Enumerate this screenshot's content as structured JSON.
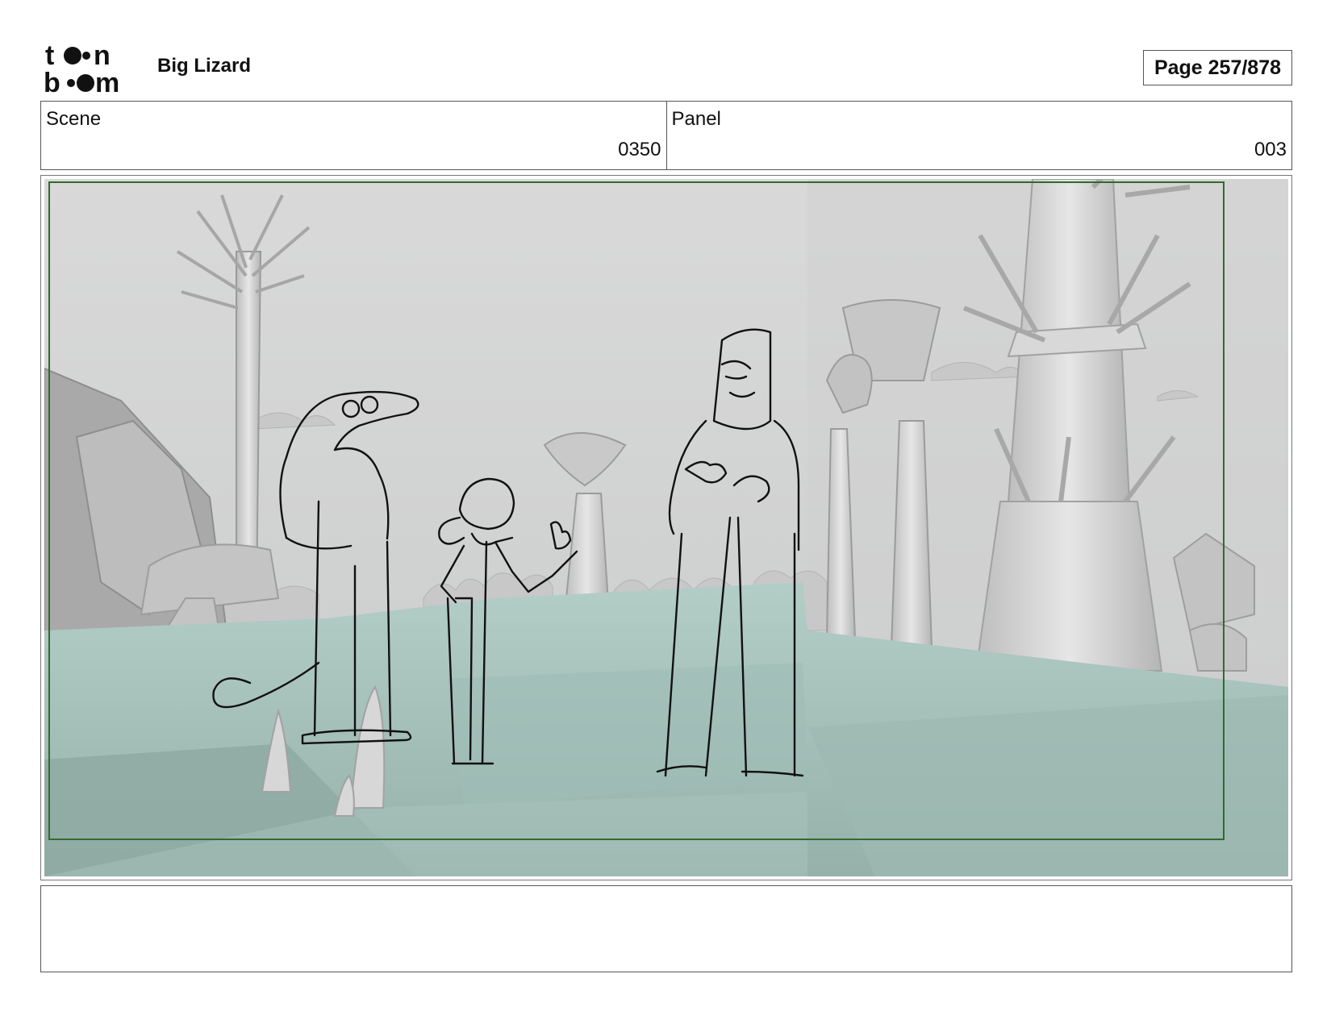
{
  "header": {
    "logo_text": "toon boom",
    "project_title": "Big Lizard",
    "page_label": "Page 257/878"
  },
  "info": {
    "scene_label": "Scene",
    "scene_value": "0350",
    "panel_label": "Panel",
    "panel_value": "003"
  },
  "panel": {
    "image_name": "storyboard-panel-forest-scene",
    "frame_color": "#2f6b2f",
    "ground_color": "#a6c4bd",
    "sky_color": "#d8d9d9"
  },
  "notes": {
    "text": ""
  }
}
